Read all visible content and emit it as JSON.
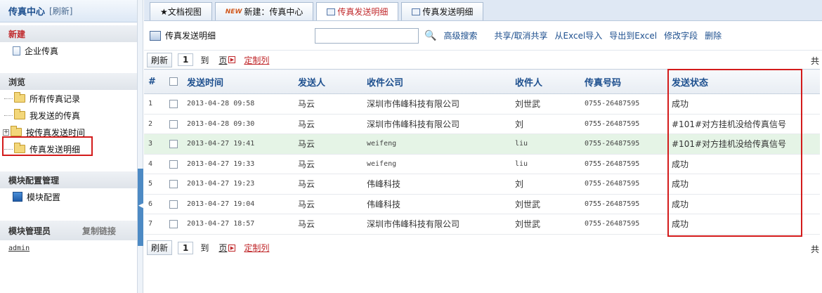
{
  "sidebar": {
    "title": "传真中心",
    "refresh": "[刷新]",
    "sections": {
      "new": "新建",
      "browse": "浏览",
      "module_config": "模块配置管理",
      "module_admin": "模块管理员"
    },
    "new_items": [
      "企业传真"
    ],
    "browse_items": [
      "所有传真记录",
      "我发送的传真",
      "按传真发送时间",
      "传真发送明细"
    ],
    "module_items": [
      "模块配置"
    ],
    "copy_link": "复制链接",
    "admin_user": "admin"
  },
  "tabs": [
    {
      "label": "★文档视图"
    },
    {
      "badge": "NEW",
      "label": "新建：传真中心"
    },
    {
      "label": "传真发送明细",
      "active": true
    },
    {
      "label": "传真发送明细"
    }
  ],
  "toolbar": {
    "title": "传真发送明细",
    "search_placeholder": "",
    "advanced_search": "高级搜索",
    "actions": [
      "共享/取消共享",
      "从Excel导入",
      "导出到Excel",
      "修改字段",
      "删除"
    ]
  },
  "pager": {
    "refresh": "刷新",
    "page": "1",
    "to": "到",
    "page_label": "页",
    "customize": "定制列",
    "total": "共"
  },
  "table": {
    "headers": [
      "#",
      "",
      "发送时间",
      "发送人",
      "收件公司",
      "收件人",
      "传真号码",
      "发送状态"
    ],
    "rows": [
      {
        "no": "1",
        "time": "2013-04-28 09:58",
        "sender": "马云",
        "company": "深圳市伟峰科技有限公司",
        "recipient": "刘世武",
        "fax": "0755-26487595",
        "status": "成功"
      },
      {
        "no": "2",
        "time": "2013-04-28 09:30",
        "sender": "马云",
        "company": "深圳市伟峰科技有限公司",
        "recipient": "刘",
        "fax": "0755-26487595",
        "status": "#101#对方挂机没给传真信号"
      },
      {
        "no": "3",
        "time": "2013-04-27 19:41",
        "sender": "马云",
        "company": "weifeng",
        "recipient": "liu",
        "fax": "0755-26487595",
        "status": "#101#对方挂机没给传真信号"
      },
      {
        "no": "4",
        "time": "2013-04-27 19:33",
        "sender": "马云",
        "company": "weifeng",
        "recipient": "liu",
        "fax": "0755-26487595",
        "status": "成功"
      },
      {
        "no": "5",
        "time": "2013-04-27 19:23",
        "sender": "马云",
        "company": "伟峰科技",
        "recipient": "刘",
        "fax": "0755-26487595",
        "status": "成功"
      },
      {
        "no": "6",
        "time": "2013-04-27 19:04",
        "sender": "马云",
        "company": "伟峰科技",
        "recipient": "刘世武",
        "fax": "0755-26487595",
        "status": "成功"
      },
      {
        "no": "7",
        "time": "2013-04-27 18:57",
        "sender": "马云",
        "company": "深圳市伟峰科技有限公司",
        "recipient": "刘世武",
        "fax": "0755-26487595",
        "status": "成功"
      }
    ]
  },
  "colors": {
    "highlight_row": "#e5f4e6",
    "annotation_red": "#d31b1b",
    "link_blue": "#1d4f8e"
  }
}
